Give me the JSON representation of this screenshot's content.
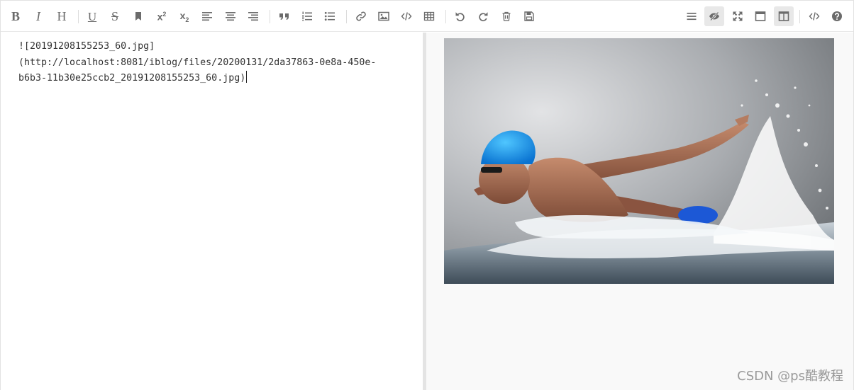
{
  "toolbar": {
    "left": [
      {
        "id": "bold",
        "icon": "bold-icon",
        "glyph": "B"
      },
      {
        "id": "italic",
        "icon": "italic-icon",
        "glyph": "I"
      },
      {
        "id": "heading",
        "icon": "heading-icon",
        "glyph": "H"
      },
      {
        "id": "underline",
        "icon": "underline-icon",
        "glyph": "U"
      },
      {
        "id": "strikethrough",
        "icon": "strikethrough-icon",
        "glyph": "S"
      },
      {
        "id": "mark",
        "icon": "bookmark-icon"
      },
      {
        "id": "superscript",
        "icon": "superscript-icon",
        "glyph": "x",
        "small": "2"
      },
      {
        "id": "subscript",
        "icon": "subscript-icon",
        "glyph": "x",
        "small": "2"
      },
      {
        "id": "align-left",
        "icon": "align-left-icon"
      },
      {
        "id": "align-center",
        "icon": "align-center-icon"
      },
      {
        "id": "align-right",
        "icon": "align-right-icon"
      },
      {
        "id": "quote",
        "icon": "quote-icon"
      },
      {
        "id": "ordered-list",
        "icon": "ordered-list-icon"
      },
      {
        "id": "unordered-list",
        "icon": "unordered-list-icon"
      },
      {
        "id": "link",
        "icon": "link-icon"
      },
      {
        "id": "image",
        "icon": "image-icon"
      },
      {
        "id": "code",
        "icon": "code-icon"
      },
      {
        "id": "table",
        "icon": "table-icon"
      },
      {
        "id": "undo",
        "icon": "undo-icon"
      },
      {
        "id": "redo",
        "icon": "redo-icon"
      },
      {
        "id": "trash",
        "icon": "trash-icon"
      },
      {
        "id": "save",
        "icon": "save-icon"
      }
    ],
    "right": [
      {
        "id": "navigation",
        "icon": "navigation-menu-icon",
        "active": false
      },
      {
        "id": "preview-toggle",
        "icon": "eye-slash-icon",
        "active": true
      },
      {
        "id": "fullscreen",
        "icon": "fullscreen-icon",
        "active": false
      },
      {
        "id": "read-mode",
        "icon": "window-icon",
        "active": false
      },
      {
        "id": "split-view",
        "icon": "split-columns-icon",
        "active": true
      },
      {
        "id": "html-code",
        "icon": "html-code-icon",
        "active": false
      },
      {
        "id": "help",
        "icon": "help-icon",
        "active": false
      }
    ]
  },
  "editor": {
    "lines": [
      "![20191208155253_60.jpg]",
      "(http://localhost:8081/iblog/files/20200131/2da37863-0e8a-450e-",
      "b6b3-11b30e25ccb2_20191208155253_60.jpg)"
    ]
  },
  "preview": {
    "image_subject": "swimmer-butterfly-photo"
  },
  "watermark": "CSDN @ps酷教程",
  "colors": {
    "icon": "#6b6b6b",
    "active_bg": "#e8e8e8",
    "divider": "#e4e4e4",
    "preview_bg": "#f9f9f9"
  }
}
